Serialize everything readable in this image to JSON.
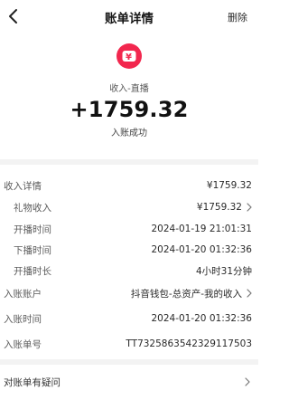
{
  "header": {
    "title": "账单详情",
    "delete_label": "删除",
    "back_icon": "chevron-left-icon"
  },
  "summary": {
    "icon": "wallet-yen-icon",
    "icon_color": "#f2274e",
    "icon_glyph": "¥",
    "source": "收入-直播",
    "amount": "+1759.32",
    "status": "入账成功"
  },
  "details": {
    "income_detail": {
      "label": "收入详情",
      "value": "¥1759.32"
    },
    "gift_income": {
      "label": "礼物收入",
      "value": "¥1759.32"
    },
    "start_time": {
      "label": "开播时间",
      "value": "2024-01-19 21:01:31"
    },
    "end_time": {
      "label": "下播时间",
      "value": "2024-01-20 01:32:36"
    },
    "duration": {
      "label": "开播时长",
      "value": "4小时31分钟"
    },
    "account": {
      "label": "入账账户",
      "value": "抖音钱包-总资产-我的收入"
    },
    "entry_time": {
      "label": "入账时间",
      "value": "2024-01-20 01:32:36"
    },
    "order_no": {
      "label": "入账单号",
      "value": "TT7325863542329117503"
    }
  },
  "dispute": {
    "label": "对账单有疑问"
  }
}
